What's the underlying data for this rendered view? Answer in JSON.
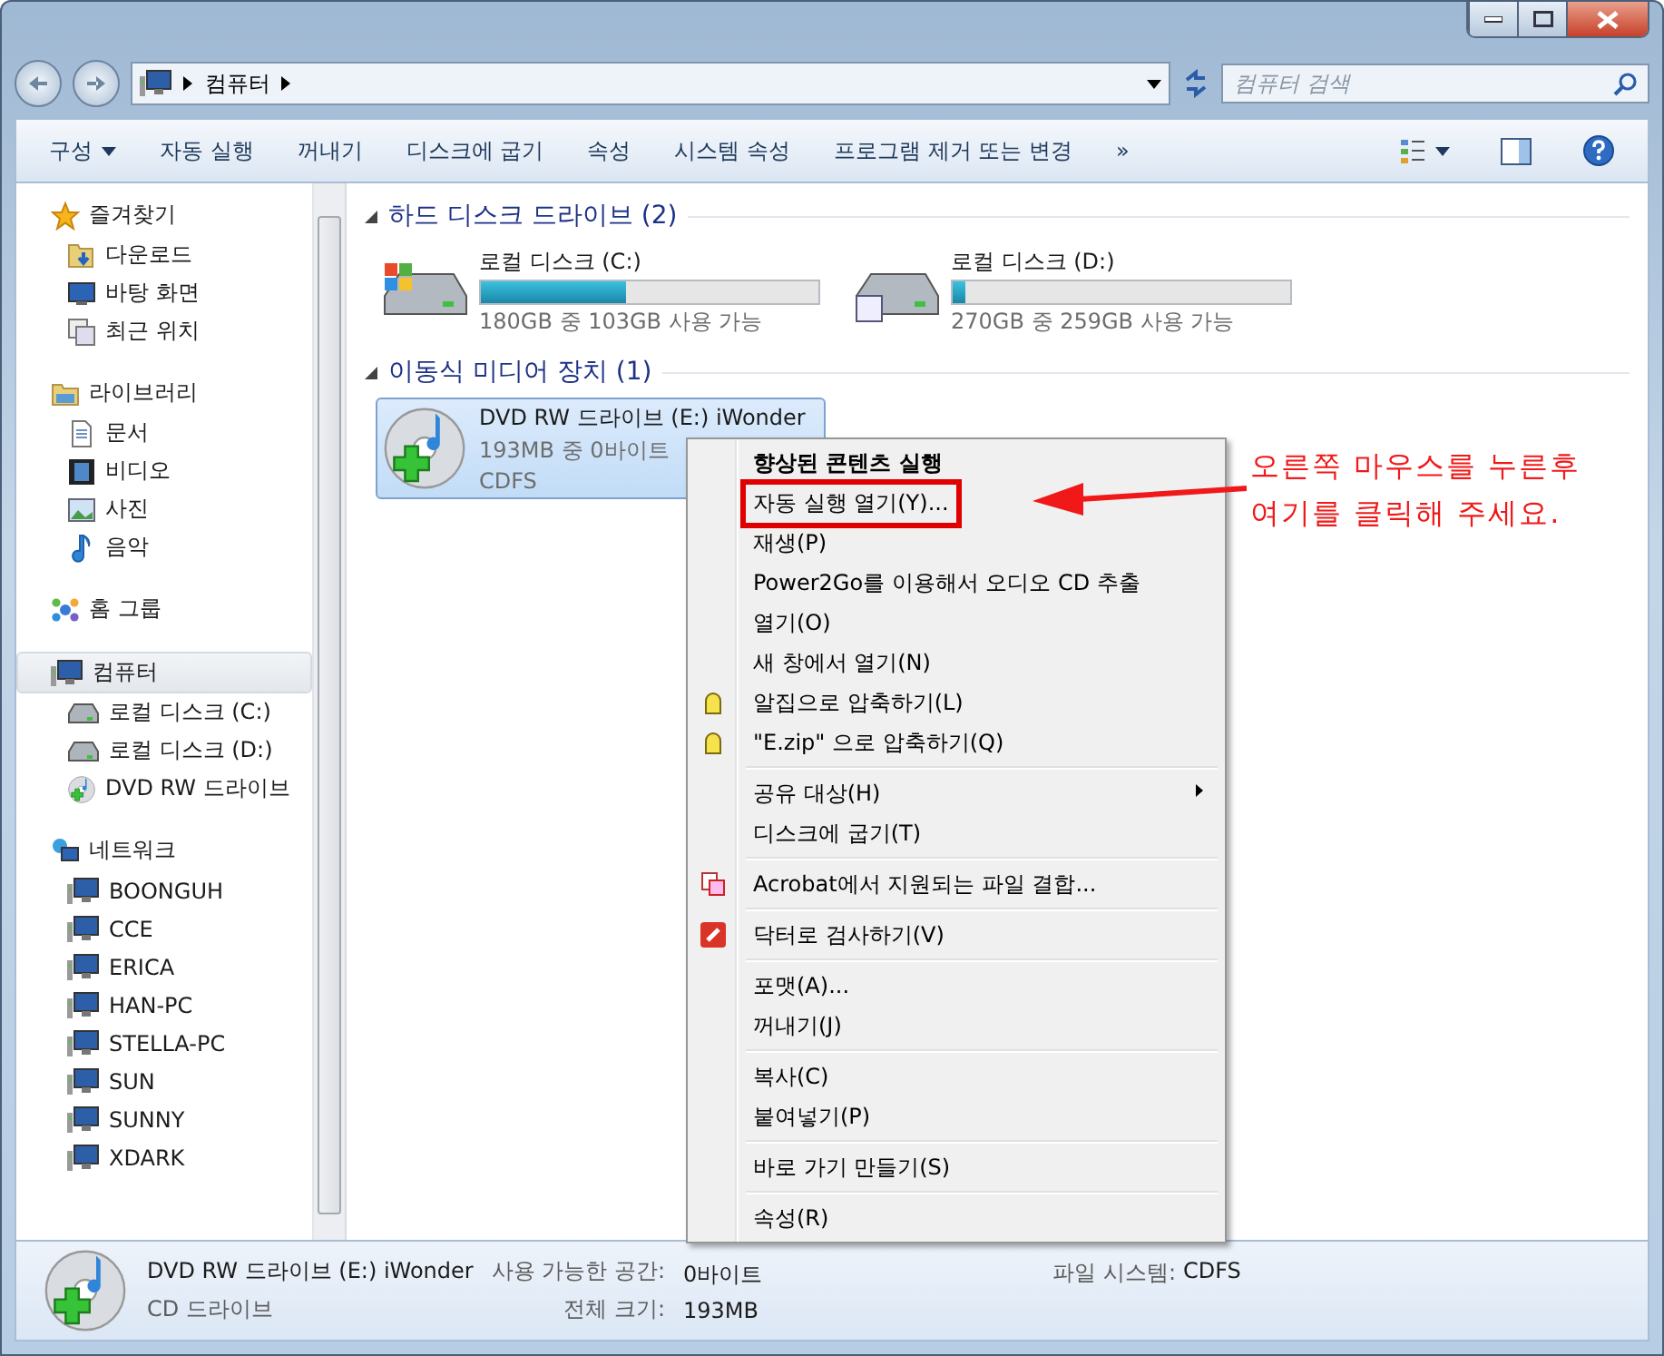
{
  "address": {
    "path": [
      "컴퓨터"
    ],
    "search_placeholder": "컴퓨터 검색"
  },
  "toolbar": {
    "items": [
      {
        "label": "구성",
        "dropdown": true
      },
      {
        "label": "자동 실행",
        "dropdown": false
      },
      {
        "label": "꺼내기",
        "dropdown": false
      },
      {
        "label": "디스크에 굽기",
        "dropdown": false
      },
      {
        "label": "속성",
        "dropdown": false
      },
      {
        "label": "시스템 속성",
        "dropdown": false
      },
      {
        "label": "프로그램 제거 또는 변경",
        "dropdown": false
      },
      {
        "label": "»",
        "dropdown": false
      }
    ]
  },
  "sidebar": {
    "groups": [
      {
        "label": "즐겨찾기",
        "kind": "star",
        "selected": false,
        "children": [
          {
            "label": "다운로드",
            "kind": "download"
          },
          {
            "label": "바탕 화면",
            "kind": "desktop"
          },
          {
            "label": "최근 위치",
            "kind": "recent"
          }
        ]
      },
      {
        "label": "라이브러리",
        "kind": "library",
        "selected": false,
        "children": [
          {
            "label": "문서",
            "kind": "document"
          },
          {
            "label": "비디오",
            "kind": "video"
          },
          {
            "label": "사진",
            "kind": "photo"
          },
          {
            "label": "음악",
            "kind": "music"
          }
        ]
      },
      {
        "label": "홈 그룹",
        "kind": "homegroup",
        "selected": false
      },
      {
        "label": "컴퓨터",
        "kind": "computer",
        "selected": true,
        "children": [
          {
            "label": "로컬 디스크 (C:)",
            "kind": "drive"
          },
          {
            "label": "로컬 디스크 (D:)",
            "kind": "drive"
          },
          {
            "label": "DVD RW 드라이브",
            "kind": "dvd"
          }
        ]
      },
      {
        "label": "네트워크",
        "kind": "network",
        "selected": false,
        "children": [
          {
            "label": "BOONGUH",
            "kind": "pc"
          },
          {
            "label": "CCE",
            "kind": "pc"
          },
          {
            "label": "ERICA",
            "kind": "pc"
          },
          {
            "label": "HAN-PC",
            "kind": "pc"
          },
          {
            "label": "STELLA-PC",
            "kind": "pc"
          },
          {
            "label": "SUN",
            "kind": "pc"
          },
          {
            "label": "SUNNY",
            "kind": "pc"
          },
          {
            "label": "XDARK",
            "kind": "pc"
          }
        ]
      }
    ]
  },
  "sections": [
    {
      "title": "하드 디스크 드라이브 (2)",
      "items": [
        {
          "kind": "drive",
          "name": "로컬 디스크 (C:)",
          "level": 0.43,
          "detail": "180GB 중 103GB 사용 가능",
          "selected": false
        },
        {
          "kind": "drive",
          "name": "로컬 디스크 (D:)",
          "level": 0.04,
          "detail": "270GB 중 259GB 사용 가능",
          "selected": false
        }
      ]
    },
    {
      "title": "이동식 미디어 장치 (1)",
      "items": [
        {
          "kind": "dvd",
          "name": "DVD RW 드라이브 (E:) iWonder",
          "detail": "193MB 중 0바이트",
          "extra": "CDFS",
          "selected": true
        }
      ]
    }
  ],
  "context_menu": {
    "items": [
      {
        "kind": "header",
        "label": "향상된 콘텐츠 실행"
      },
      {
        "kind": "item",
        "label": "자동 실행 열기(Y)...",
        "annotated": true
      },
      {
        "kind": "item",
        "label": "재생(P)"
      },
      {
        "kind": "item",
        "label": "Power2Go를 이용해서 오디오 CD 추출"
      },
      {
        "kind": "item",
        "label": "열기(O)"
      },
      {
        "kind": "item",
        "label": "새 창에서 열기(N)"
      },
      {
        "kind": "archive",
        "label": "알집으로 압축하기(L)"
      },
      {
        "kind": "archive",
        "label": "\"E.zip\" 으로 압축하기(Q)"
      },
      {
        "kind": "separator"
      },
      {
        "kind": "item",
        "label": "공유 대상(H)",
        "submenu": true
      },
      {
        "kind": "item",
        "label": "디스크에 굽기(T)"
      },
      {
        "kind": "separator"
      },
      {
        "kind": "combine",
        "label": "Acrobat에서 지원되는 파일 결합..."
      },
      {
        "kind": "separator"
      },
      {
        "kind": "scan",
        "label": "닥터로 검사하기(V)"
      },
      {
        "kind": "separator"
      },
      {
        "kind": "item",
        "label": "포맷(A)..."
      },
      {
        "kind": "item",
        "label": "꺼내기(J)"
      },
      {
        "kind": "separator"
      },
      {
        "kind": "item",
        "label": "복사(C)"
      },
      {
        "kind": "item",
        "label": "붙여넣기(P)"
      },
      {
        "kind": "separator"
      },
      {
        "kind": "item",
        "label": "바로 가기 만들기(S)"
      },
      {
        "kind": "separator"
      },
      {
        "kind": "item",
        "label": "속성(R)"
      }
    ]
  },
  "annotation": {
    "lines": [
      "오른쪽 마우스를 누른후",
      "여기를 클릭해 주세요."
    ]
  },
  "status_bar": {
    "name": "DVD RW 드라이브 (E:) iWonder",
    "type": "CD 드라이브",
    "fields": [
      {
        "label": "사용 가능한 공간:",
        "value": "0바이트"
      },
      {
        "label": "전체 크기:",
        "value": "193MB"
      },
      {
        "label": "파일 시스템:",
        "value": "CDFS"
      }
    ]
  }
}
